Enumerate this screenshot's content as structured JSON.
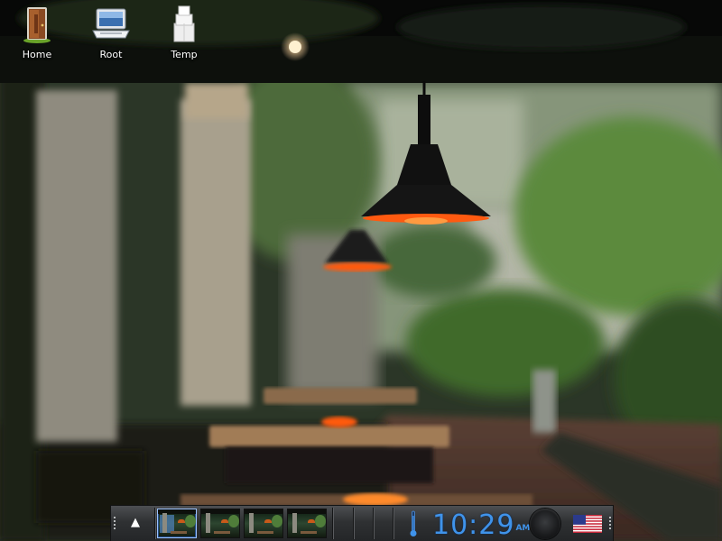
{
  "desktop": {
    "icons": [
      {
        "label": "Home",
        "icon": "home-door-icon"
      },
      {
        "label": "Root",
        "icon": "computer-icon"
      },
      {
        "label": "Temp",
        "icon": "boxes-icon"
      }
    ]
  },
  "panel": {
    "up_button": "▲",
    "workspaces": [
      {
        "name": "workspace-1",
        "active": true
      },
      {
        "name": "workspace-2",
        "active": false
      },
      {
        "name": "workspace-3",
        "active": false
      },
      {
        "name": "workspace-4",
        "active": false
      }
    ],
    "clock": {
      "time": "10:29",
      "ampm": "AM"
    },
    "keyboard_layout_icon": "us-flag-icon",
    "thermometer_icon": "thermometer-icon",
    "volume_icon": "volume-knob-icon"
  },
  "colors": {
    "clock_blue": "#3f93ea",
    "panel_dark": "#2f3133",
    "lamp_glow": "#ff6a1a"
  }
}
